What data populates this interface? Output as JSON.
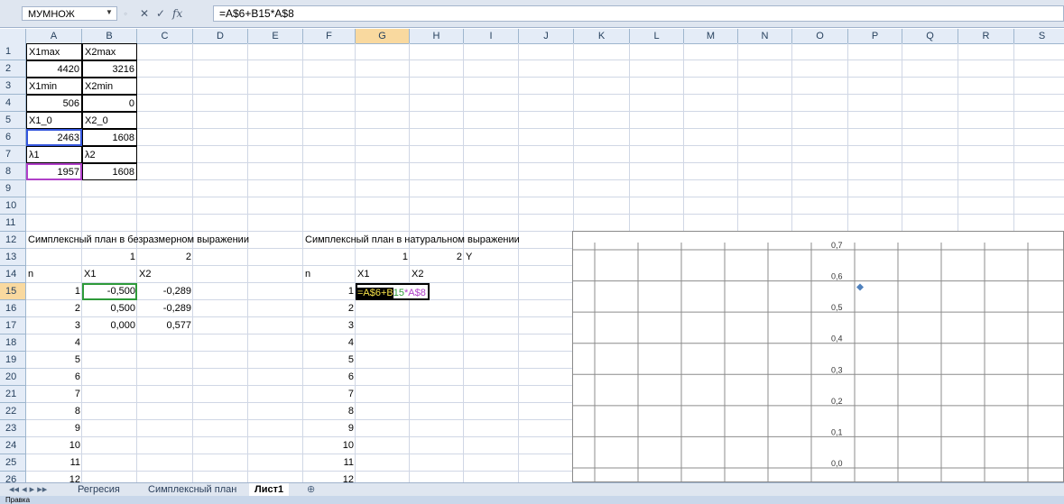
{
  "formula_bar": {
    "name_box": "МУМНОЖ",
    "fx": "fx",
    "cancel": "✕",
    "enter": "✓",
    "formula": "=A$6+B15*A$8"
  },
  "columns": [
    "A",
    "B",
    "C",
    "D",
    "E",
    "F",
    "G",
    "H",
    "I",
    "J",
    "K",
    "L",
    "M",
    "N",
    "O",
    "P",
    "Q",
    "R",
    "S"
  ],
  "rows": [
    "1",
    "2",
    "3",
    "4",
    "5",
    "6",
    "7",
    "8",
    "9",
    "10",
    "11",
    "12",
    "13",
    "14",
    "15",
    "16",
    "17",
    "18",
    "19",
    "20",
    "21",
    "22",
    "23",
    "24",
    "25",
    "26"
  ],
  "cells": {
    "A1": "X1max",
    "B1": "X2max",
    "A2": "4420",
    "B2": "3216",
    "A3": "X1min",
    "B3": "X2min",
    "A4": "506",
    "B4": "0",
    "A5": "X1_0",
    "B5": "X2_0",
    "A6": "2463",
    "B6": "1608",
    "A7": "λ1",
    "B7": "λ2",
    "A8": "1957",
    "B8": "1608",
    "A12": "Симплексный план в безразмерном выражении",
    "F12": "Симплексный план в натуральном выражении",
    "B13": "1",
    "C13": "2",
    "G13": "1",
    "H13": "2",
    "I13": "Y",
    "A14": "n",
    "B14": "X1",
    "C14": "X2",
    "F14": "n",
    "G14": "X1",
    "H14": "X2",
    "A15": "1",
    "B15": "-0,500",
    "C15": "-0,289",
    "A16": "2",
    "B16": "0,500",
    "C16": "-0,289",
    "A17": "3",
    "B17": "0,000",
    "C17": "0,577",
    "A18": "4",
    "A19": "5",
    "A20": "6",
    "A21": "7",
    "A22": "8",
    "A23": "9",
    "A24": "10",
    "A25": "11",
    "A26": "12",
    "F15": "1",
    "F16": "2",
    "F17": "3",
    "F18": "4",
    "F19": "5",
    "F20": "6",
    "F21": "7",
    "F22": "8",
    "F23": "9",
    "F24": "10",
    "F25": "11",
    "F26": "12"
  },
  "edit_cell": {
    "part1": "=A$6+B",
    "part2": "15",
    "part3": "*A$8"
  },
  "sheet_tabs": [
    "Регресия",
    "Симплексный план",
    "Лист1"
  ],
  "active_tab": "Лист1",
  "status": "Правка",
  "chart_data": {
    "type": "scatter",
    "y_ticks": [
      "0,0",
      "0,1",
      "0,2",
      "0,3",
      "0,4",
      "0,5",
      "0,6",
      "0,7"
    ],
    "ylim": [
      0,
      0.7
    ],
    "points": [
      {
        "x": 0,
        "y": 0.58
      }
    ],
    "marker_color": "#4f81bd",
    "grid": true
  }
}
